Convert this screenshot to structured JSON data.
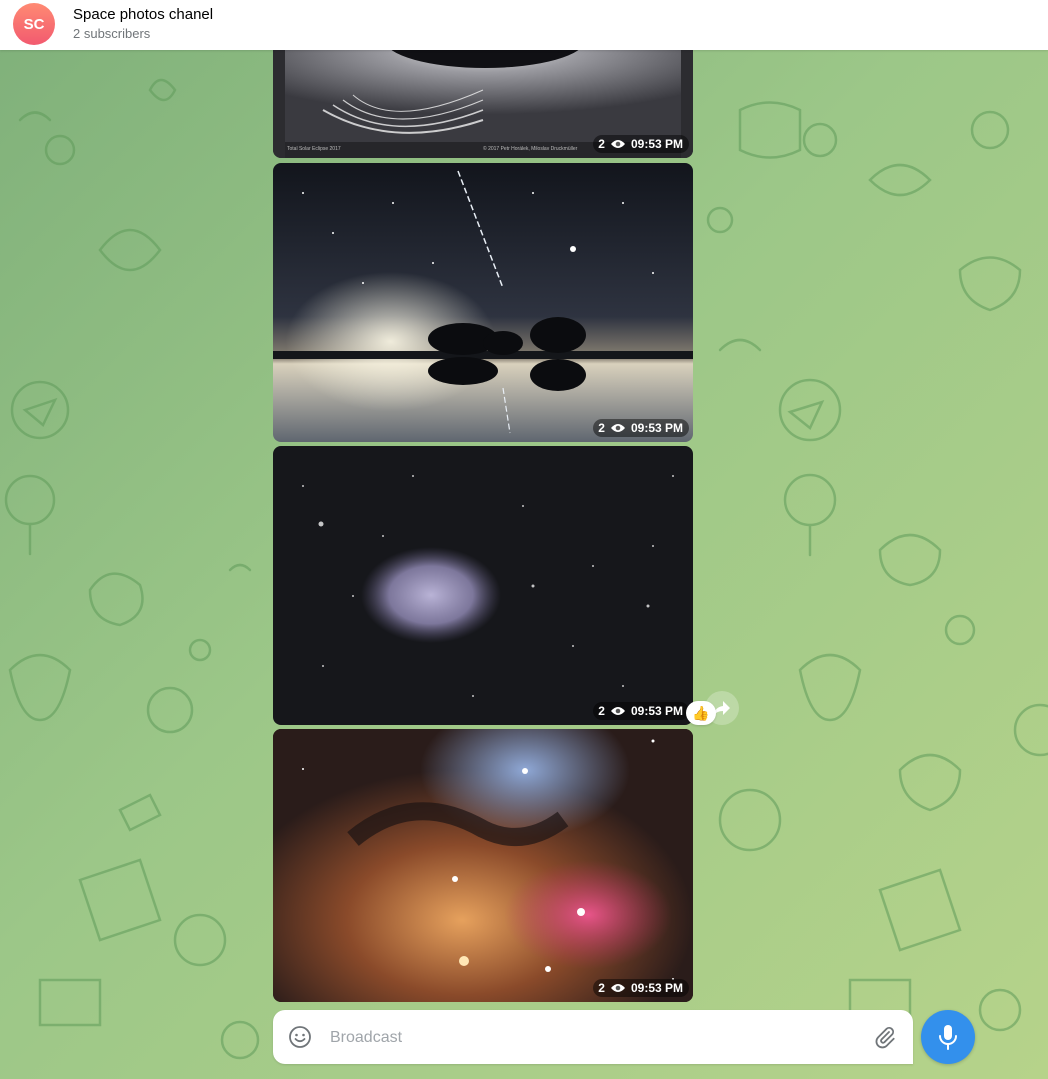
{
  "header": {
    "avatar_initials": "SC",
    "channel_name": "Space photos chanel",
    "subscribers": "2 subscribers"
  },
  "messages": [
    {
      "views": "2",
      "time": "09:53 PM",
      "caption_left": "Total Solar Eclipse 2017",
      "caption_right": "© 2017 Petr Horálek, Miloslav Druckmüller",
      "subject": "solar eclipse corona"
    },
    {
      "views": "2",
      "time": "09:53 PM",
      "subject": "night sky with satellite trail over lake reflection"
    },
    {
      "views": "2",
      "time": "09:53 PM",
      "subject": "comet among stars"
    },
    {
      "views": "2",
      "time": "09:53 PM",
      "subject": "colorful nebula"
    }
  ],
  "reaction": {
    "emoji": "👍"
  },
  "composer": {
    "placeholder": "Broadcast",
    "value": ""
  },
  "icons": {
    "views": "eye-icon",
    "emoji": "smile-icon",
    "attach": "paperclip-icon",
    "mic": "microphone-icon",
    "share": "share-arrow-icon"
  },
  "colors": {
    "accent": "#3390ec",
    "avatar_top": "#ff8a73",
    "avatar_bottom": "#f25a6f",
    "chat_bg_start": "#7fb07a",
    "chat_bg_end": "#b6d38a"
  }
}
